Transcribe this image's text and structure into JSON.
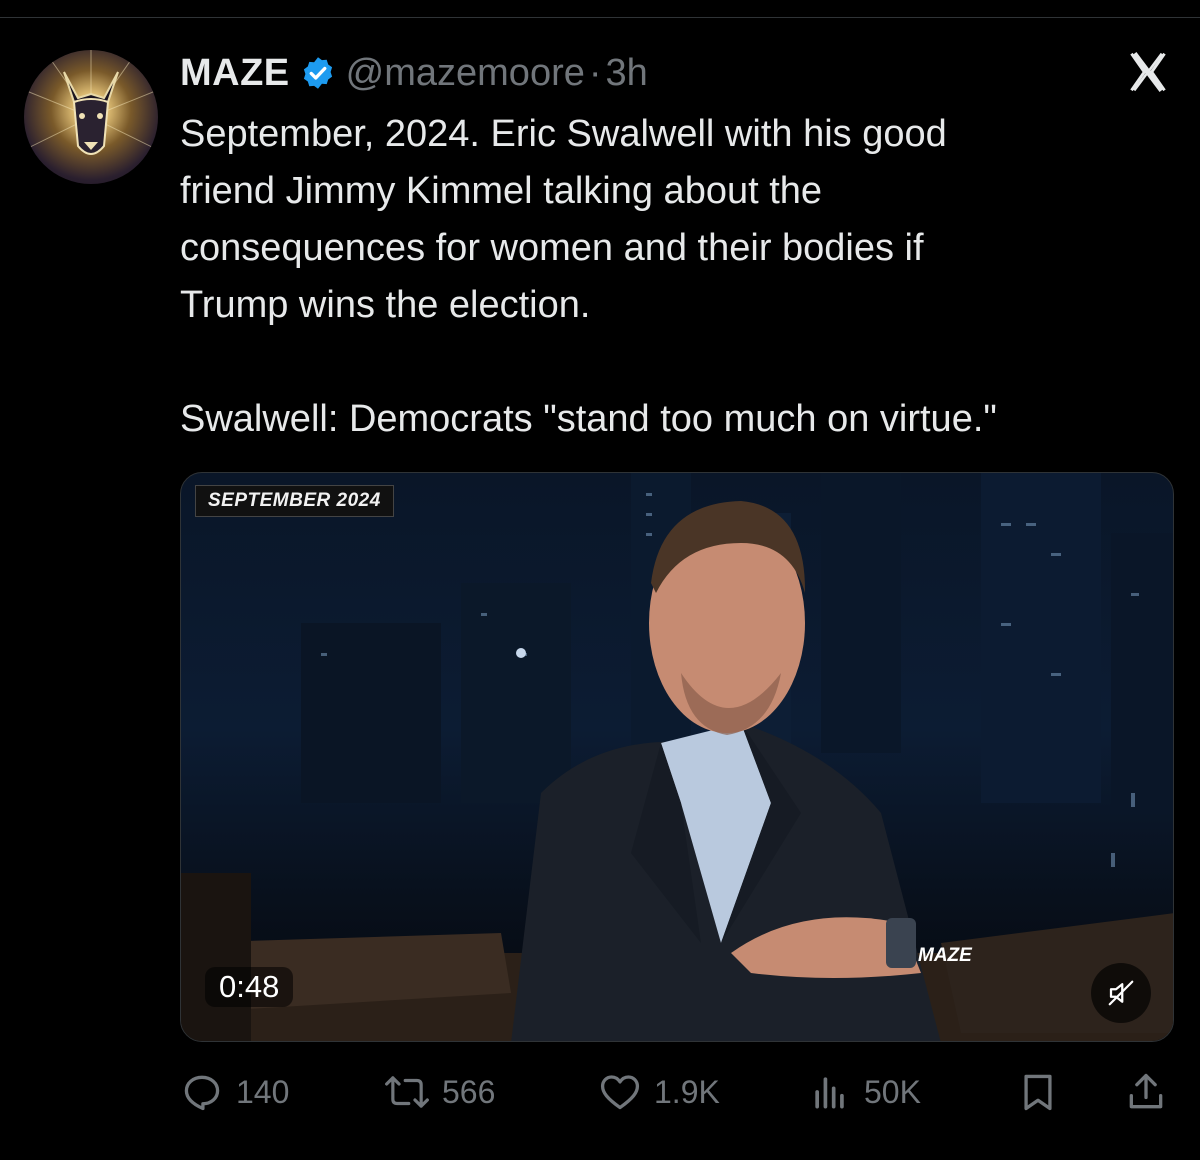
{
  "author": {
    "name": "MAZE",
    "handle": "@mazemoore",
    "separator": "·",
    "time": "3h",
    "verified_icon": "verified-badge-icon",
    "avatar": "doberman-logo-avatar"
  },
  "tweet": {
    "text_lines": [
      "September, 2024. Eric Swalwell with his good",
      "friend Jimmy Kimmel talking about the",
      "consequences for women and their bodies if",
      "Trump wins the election."
    ],
    "quote": "Swalwell: Democrats \"stand too much on virtue.\""
  },
  "media": {
    "type": "video",
    "date_tag": "SEPTEMBER 2024",
    "watermark": "MAZE",
    "duration": "0:48",
    "mute_icon": "muted-speaker-icon"
  },
  "actions": {
    "replies": "140",
    "reposts": "566",
    "likes": "1.9K",
    "views": "50K",
    "bookmark_icon": "bookmark-icon",
    "share_icon": "share-icon"
  },
  "colors": {
    "background": "#000000",
    "text": "#e7e9ea",
    "muted": "#71767b",
    "verified": "#1d9bf0",
    "divider": "#2f3336"
  }
}
